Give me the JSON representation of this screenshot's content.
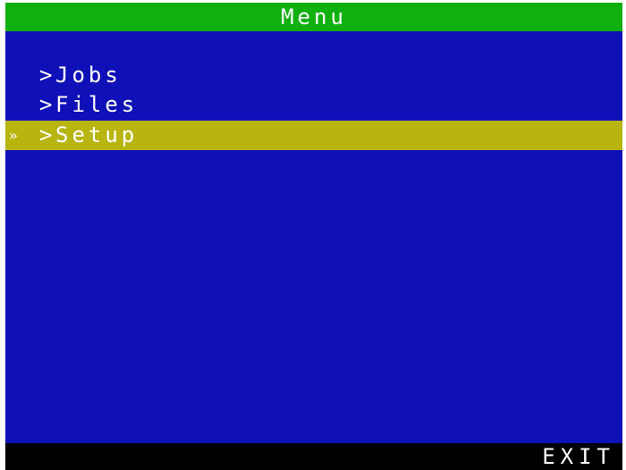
{
  "title": "Menu",
  "menu": {
    "items": [
      {
        "label": "Jobs",
        "arrow": ">",
        "cursor": "",
        "selected": false
      },
      {
        "label": "Files",
        "arrow": ">",
        "cursor": "",
        "selected": false
      },
      {
        "label": "Setup",
        "arrow": ">",
        "cursor": "»",
        "selected": true
      }
    ]
  },
  "footer": {
    "exit_label": "EXIT"
  },
  "colors": {
    "title_bar": "#10b010",
    "menu_background": "#1010b8",
    "selected_row": "#b8b410",
    "footer_bar": "#000000",
    "text": "#ffffff"
  }
}
